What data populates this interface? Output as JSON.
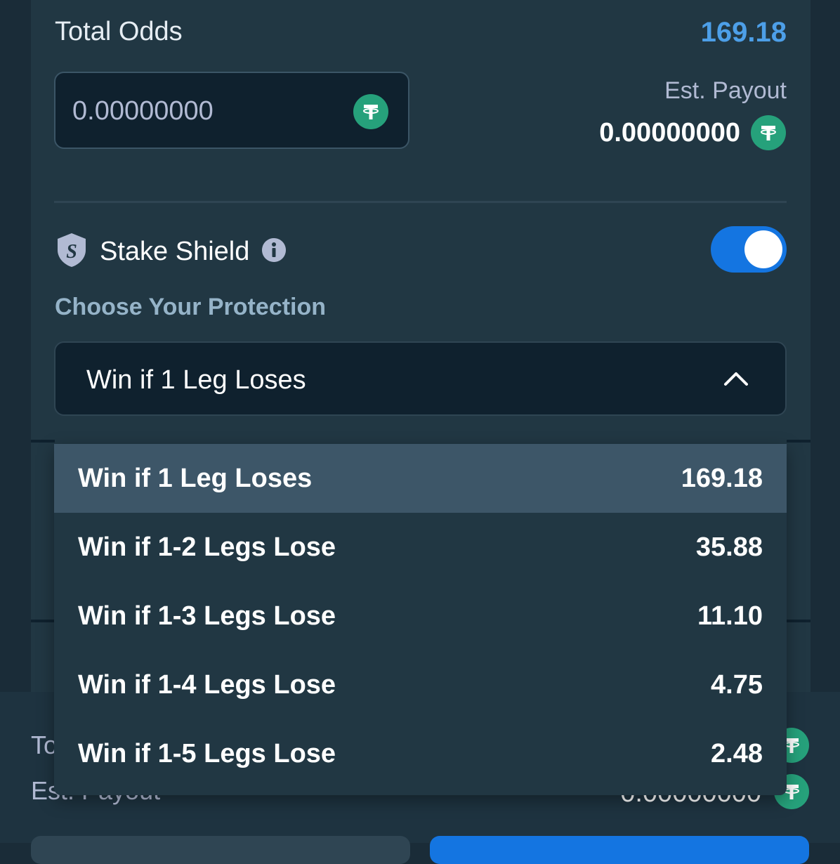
{
  "header": {
    "total_odds_label": "Total Odds",
    "total_odds_value": "169.18"
  },
  "stake": {
    "amount": "0.00000000",
    "currency_icon": "tether-icon"
  },
  "payout": {
    "label": "Est. Payout",
    "value": "0.00000000"
  },
  "shield": {
    "label": "Stake Shield",
    "enabled": true
  },
  "protection": {
    "heading": "Choose Your Protection",
    "selected": "Win if 1 Leg Loses"
  },
  "options": [
    {
      "label": "Win if 1 Leg Loses",
      "odds": "169.18"
    },
    {
      "label": "Win if 1-2 Legs Lose",
      "odds": "35.88"
    },
    {
      "label": "Win if 1-3 Legs Lose",
      "odds": "11.10"
    },
    {
      "label": "Win if 1-4 Legs Lose",
      "odds": "4.75"
    },
    {
      "label": "Win if 1-5 Legs Lose",
      "odds": "2.48"
    }
  ],
  "background": {
    "partial_label_1": "To",
    "partial_label_2": "Est. Payout",
    "partial_value": "0.00000000"
  },
  "colors": {
    "accent_blue": "#1475e1",
    "odds_blue": "#4d9fe8",
    "tether_green": "#26a17b",
    "panel": "#213743"
  }
}
